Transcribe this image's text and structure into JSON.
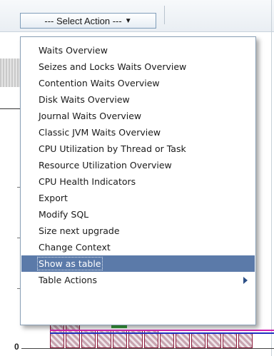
{
  "toolbar": {
    "select_action_label": "--- Select Action ---",
    "select_action_caret": "▼"
  },
  "menu": {
    "items": [
      {
        "label": "Waits Overview"
      },
      {
        "label": "Seizes and Locks Waits Overview"
      },
      {
        "label": "Contention Waits Overview"
      },
      {
        "label": "Disk Waits Overview"
      },
      {
        "label": "Journal Waits Overview"
      },
      {
        "label": "Classic JVM Waits Overview"
      },
      {
        "label": "CPU Utilization by Thread or Task"
      },
      {
        "label": "Resource Utilization Overview"
      },
      {
        "label": "CPU Health Indicators"
      },
      {
        "label": "Export"
      },
      {
        "label": "Modify SQL"
      },
      {
        "label": "Size next upgrade"
      },
      {
        "label": "Change Context"
      },
      {
        "label": "Show as table",
        "selected": true
      },
      {
        "label": "Table Actions",
        "has_submenu": true
      }
    ],
    "selected_color": "#5b7aa9"
  },
  "chart": {
    "y_axis_zero_label": "0"
  }
}
